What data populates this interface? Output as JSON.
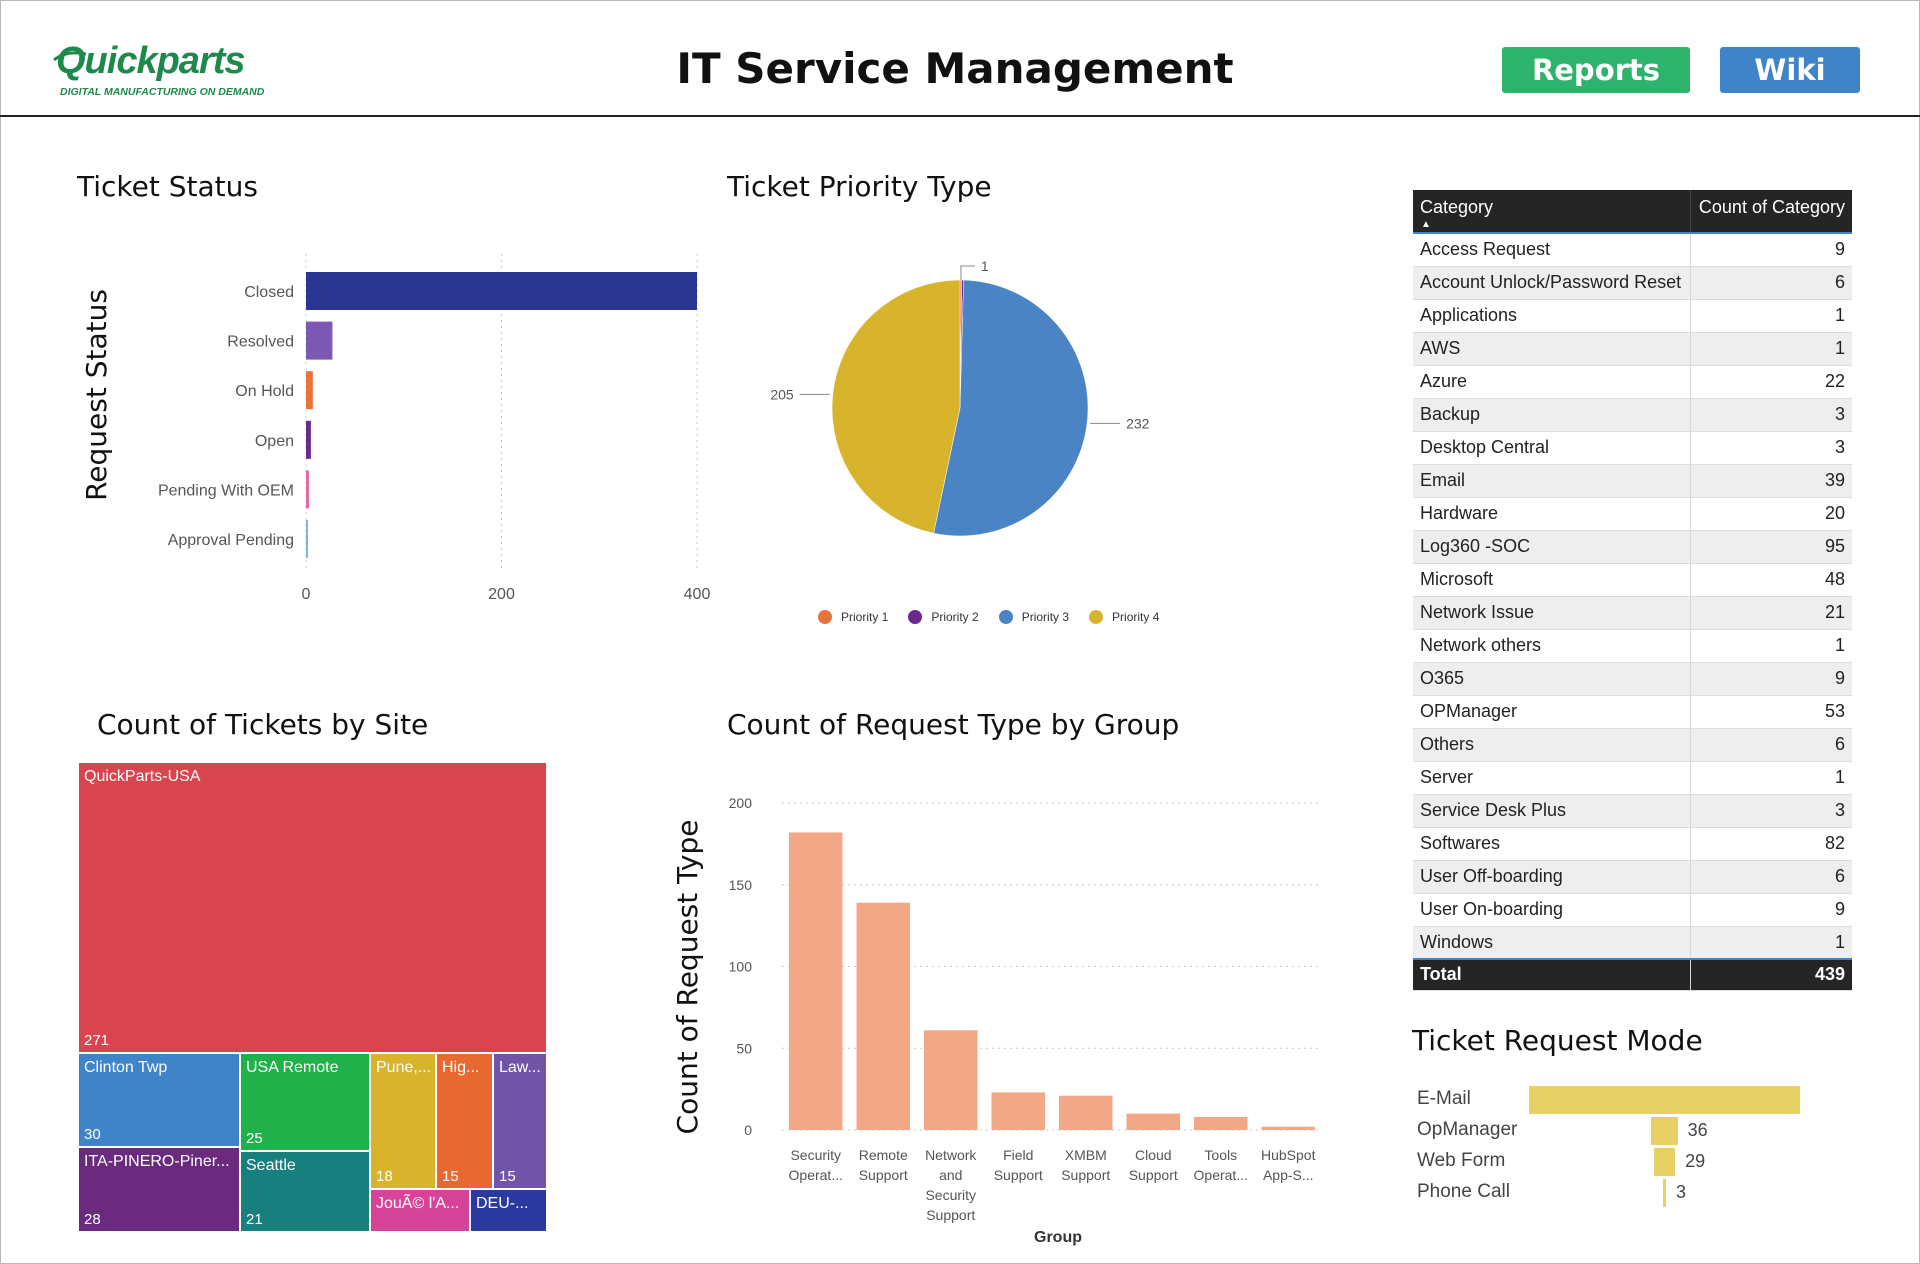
{
  "header": {
    "logo_text": "Quickparts",
    "logo_tagline": "DIGITAL MANUFACTURING ON DEMAND",
    "title": "IT Service Management",
    "reports_label": "Reports",
    "wiki_label": "Wiki"
  },
  "colors": {
    "brand_green": "#1d8a4c",
    "reports_button": "#2db36b",
    "wiki_button": "#3f83c8",
    "status_bar_closed": "#2b3592"
  },
  "titles": {
    "ticket_status": "Ticket Status",
    "priority": "Ticket Priority Type",
    "site": "Count of Tickets by Site",
    "request_group": "Count of Request Type by Group",
    "request_mode": "Ticket Request Mode"
  },
  "chart_data": [
    {
      "id": "ticket_status",
      "type": "bar",
      "orientation": "horizontal",
      "title": "Ticket Status",
      "ylabel": "Request Status",
      "categories": [
        "Closed",
        "Resolved",
        "On Hold",
        "Open",
        "Pending With OEM",
        "Approval Pending"
      ],
      "category_labels": [
        "Closed",
        "Resolved",
        "On Hold",
        "Open",
        "Pending With OEM",
        "Approval Pending"
      ],
      "values": [
        400,
        27,
        7,
        5,
        3,
        2
      ],
      "colors": [
        "#2b3592",
        "#7b58b3",
        "#e8743b",
        "#6a2a8c",
        "#e266a8",
        "#7eb6d9"
      ],
      "xlim": [
        0,
        400
      ],
      "xticks": [
        0,
        200,
        400
      ],
      "grid": true
    },
    {
      "id": "priority",
      "type": "pie",
      "title": "Ticket Priority Type",
      "slices": [
        {
          "name": "Priority 1",
          "value": 1,
          "color": "#e8743b",
          "label": "1"
        },
        {
          "name": "Priority 2",
          "value": 1,
          "color": "#6a2a8c",
          "label": ""
        },
        {
          "name": "Priority 3",
          "value": 232,
          "color": "#4a84c4",
          "label": "232"
        },
        {
          "name": "Priority 4",
          "value": 205,
          "color": "#d8b42c",
          "label": "205"
        }
      ],
      "legend": "bottom"
    },
    {
      "id": "site",
      "type": "treemap",
      "title": "Count of Tickets by Site",
      "items": [
        {
          "label": "QuickParts-USA",
          "value": "271",
          "color": "#d9444f"
        },
        {
          "label": "Clinton Twp",
          "value": "30",
          "color": "#3f83c8"
        },
        {
          "label": "USA Remote",
          "value": "25",
          "color": "#20b14b"
        },
        {
          "label": "Pune,...",
          "value": "18",
          "color": "#d8b42c"
        },
        {
          "label": "Hig...",
          "value": "15",
          "color": "#e8692f"
        },
        {
          "label": "Law...",
          "value": "15",
          "color": "#7154a8"
        },
        {
          "label": "ITA-PINERO-Piner...",
          "value": "28",
          "color": "#6a2a7e"
        },
        {
          "label": "Seattle",
          "value": "21",
          "color": "#177f7d"
        },
        {
          "label": "JouÃ© l'A...",
          "value": "",
          "color": "#d6449a"
        },
        {
          "label": "DEU-...",
          "value": "",
          "color": "#2a3a9e"
        }
      ]
    },
    {
      "id": "request_group",
      "type": "bar",
      "title": "Count of Request Type by Group",
      "xlabel": "Group",
      "ylabel": "Count of Request Type",
      "categories": [
        "Security Operat...",
        "Remote Support",
        "Network and Security Support",
        "Field Support",
        "XMBM Support",
        "Cloud Support",
        "Tools Operat...",
        "HubSpot App-S..."
      ],
      "category_lines": [
        [
          "Security",
          "Operat..."
        ],
        [
          "Remote",
          "Support"
        ],
        [
          "Network",
          "and",
          "Security",
          "Support"
        ],
        [
          "Field",
          "Support"
        ],
        [
          "XMBM",
          "Support"
        ],
        [
          "Cloud",
          "Support"
        ],
        [
          "Tools",
          "Operat..."
        ],
        [
          "HubSpot",
          "App-S..."
        ]
      ],
      "values": [
        182,
        139,
        61,
        23,
        21,
        10,
        8,
        2
      ],
      "color": "#f2a886",
      "ylim": [
        0,
        200
      ],
      "yticks": [
        0,
        50,
        100,
        150,
        200
      ],
      "grid": true
    },
    {
      "id": "request_mode",
      "type": "bar",
      "orientation": "horizontal",
      "title": "Ticket Request Mode",
      "categories": [
        "E-Mail",
        "OpManager",
        "Web Form",
        "Phone Call"
      ],
      "values": [
        370,
        36,
        29,
        3
      ],
      "value_labels": [
        "",
        "36",
        "29",
        "3"
      ],
      "color": "#e8d164",
      "xlim": [
        0,
        370
      ]
    },
    {
      "id": "category_table",
      "type": "table",
      "columns": [
        "Category",
        "Count of Category"
      ],
      "rows": [
        [
          "Access Request",
          "9"
        ],
        [
          "Account Unlock/Password Reset",
          "6"
        ],
        [
          "Applications",
          "1"
        ],
        [
          "AWS",
          "1"
        ],
        [
          "Azure",
          "22"
        ],
        [
          "Backup",
          "3"
        ],
        [
          "Desktop Central",
          "3"
        ],
        [
          "Email",
          "39"
        ],
        [
          "Hardware",
          "20"
        ],
        [
          "Log360 -SOC",
          "95"
        ],
        [
          "Microsoft",
          "48"
        ],
        [
          "Network Issue",
          "21"
        ],
        [
          "Network others",
          "1"
        ],
        [
          "O365",
          "9"
        ],
        [
          "OPManager",
          "53"
        ],
        [
          "Others",
          "6"
        ],
        [
          "Server",
          "1"
        ],
        [
          "Service Desk Plus",
          "3"
        ],
        [
          "Softwares",
          "82"
        ],
        [
          "User Off-boarding",
          "6"
        ],
        [
          "User On-boarding",
          "9"
        ],
        [
          "Windows",
          "1"
        ]
      ],
      "total": [
        "Total",
        "439"
      ]
    }
  ]
}
